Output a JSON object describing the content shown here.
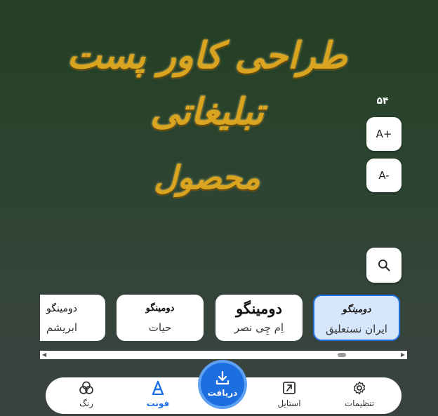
{
  "preview": {
    "line1": "طراحی کاور پست تبلیغاتی",
    "line2": "محصول"
  },
  "size_controls": {
    "size_value": "۵۴",
    "increase_label": "A+",
    "decrease_label": "A-"
  },
  "fonts": [
    {
      "sample": "دومینگو",
      "name": "ایران نستعلیق",
      "selected": true
    },
    {
      "sample": "دومینگو",
      "name": "اِم چِی نصر",
      "selected": false
    },
    {
      "sample": "دومینگو",
      "name": "حیات",
      "selected": false
    },
    {
      "sample": "دومینگو",
      "name": "ابریشم",
      "selected": false
    }
  ],
  "nav": {
    "settings": "تنظیمات",
    "style": "استایل",
    "download": "دریافت",
    "font": "فونت",
    "color": "رنگ"
  },
  "colors": {
    "accent": "#1d6fe0",
    "title_gold": "#d9a520"
  }
}
